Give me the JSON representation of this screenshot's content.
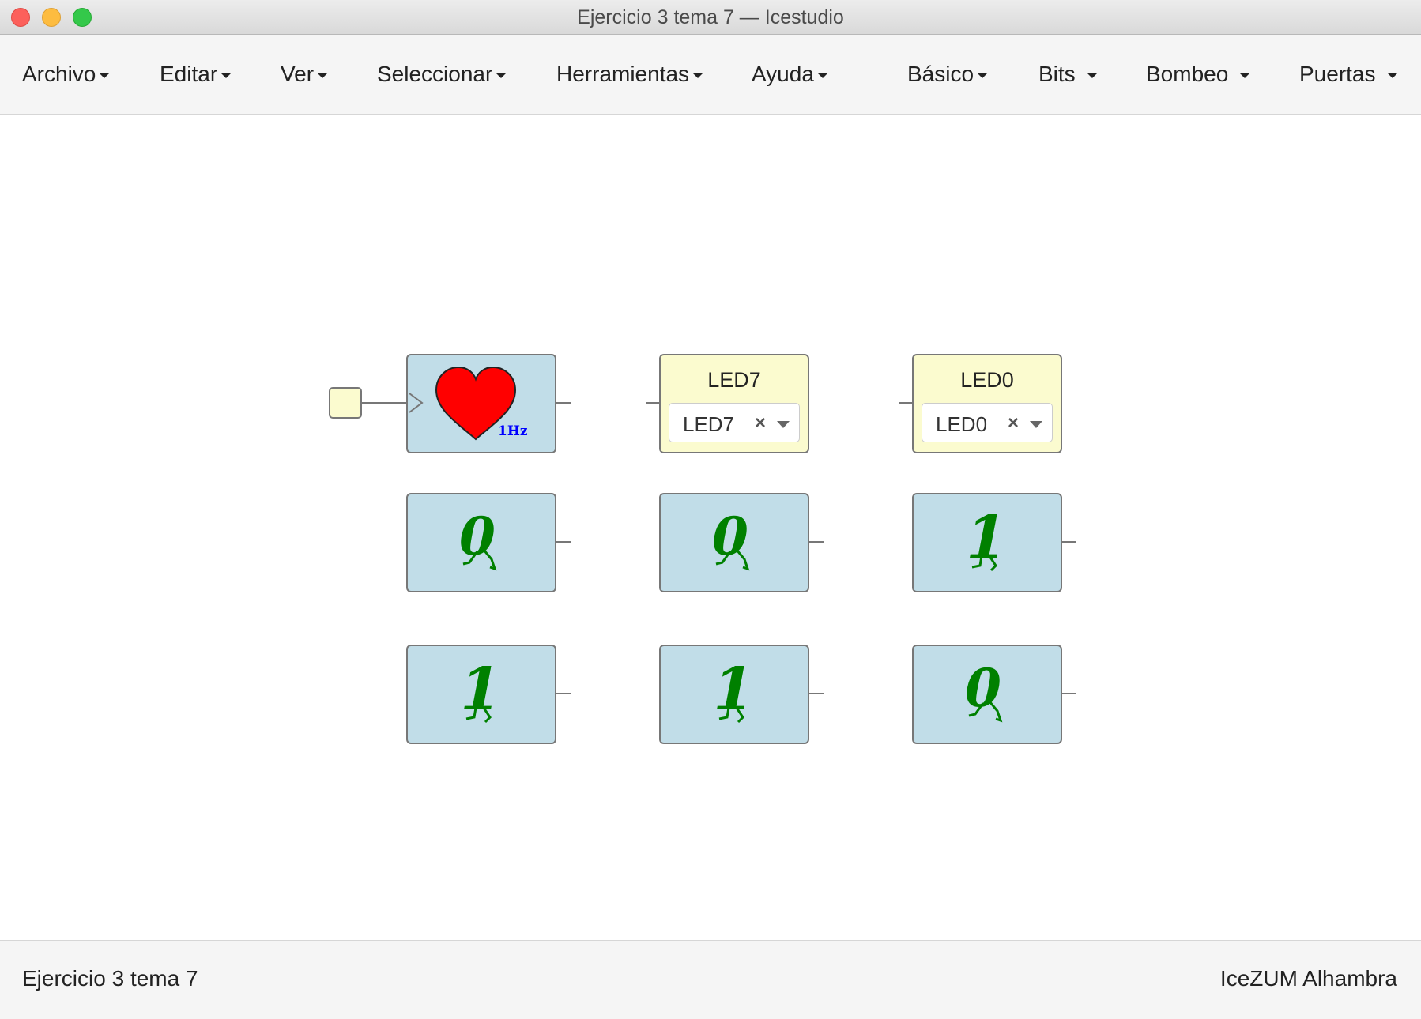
{
  "window": {
    "title": "Ejercicio 3 tema 7 — Icestudio"
  },
  "menu": {
    "archivo": "Archivo",
    "editar": "Editar",
    "ver": "Ver",
    "seleccionar": "Seleccionar",
    "herramientas": "Herramientas",
    "ayuda": "Ayuda",
    "basico": "Básico",
    "bits": "Bits",
    "bombeo": "Bombeo",
    "puertas": "Puertas"
  },
  "canvas": {
    "clock": {
      "icon": "heart-icon",
      "label": "1Hz",
      "color": "#ff0000"
    },
    "led7": {
      "label": "LED7",
      "selected": "LED7"
    },
    "led0": {
      "label": "LED0",
      "selected": "LED0"
    },
    "constants": {
      "r1c1": "0",
      "r1c2": "0",
      "r1c3": "1",
      "r2c1": "1",
      "r2c2": "1",
      "r2c3": "0"
    }
  },
  "status": {
    "project": "Ejercicio 3 tema 7",
    "board": "IceZUM Alhambra"
  },
  "colors": {
    "block_blue": "#c1dde8",
    "block_yellow": "#fbfbcf",
    "digit_green": "#008000"
  }
}
